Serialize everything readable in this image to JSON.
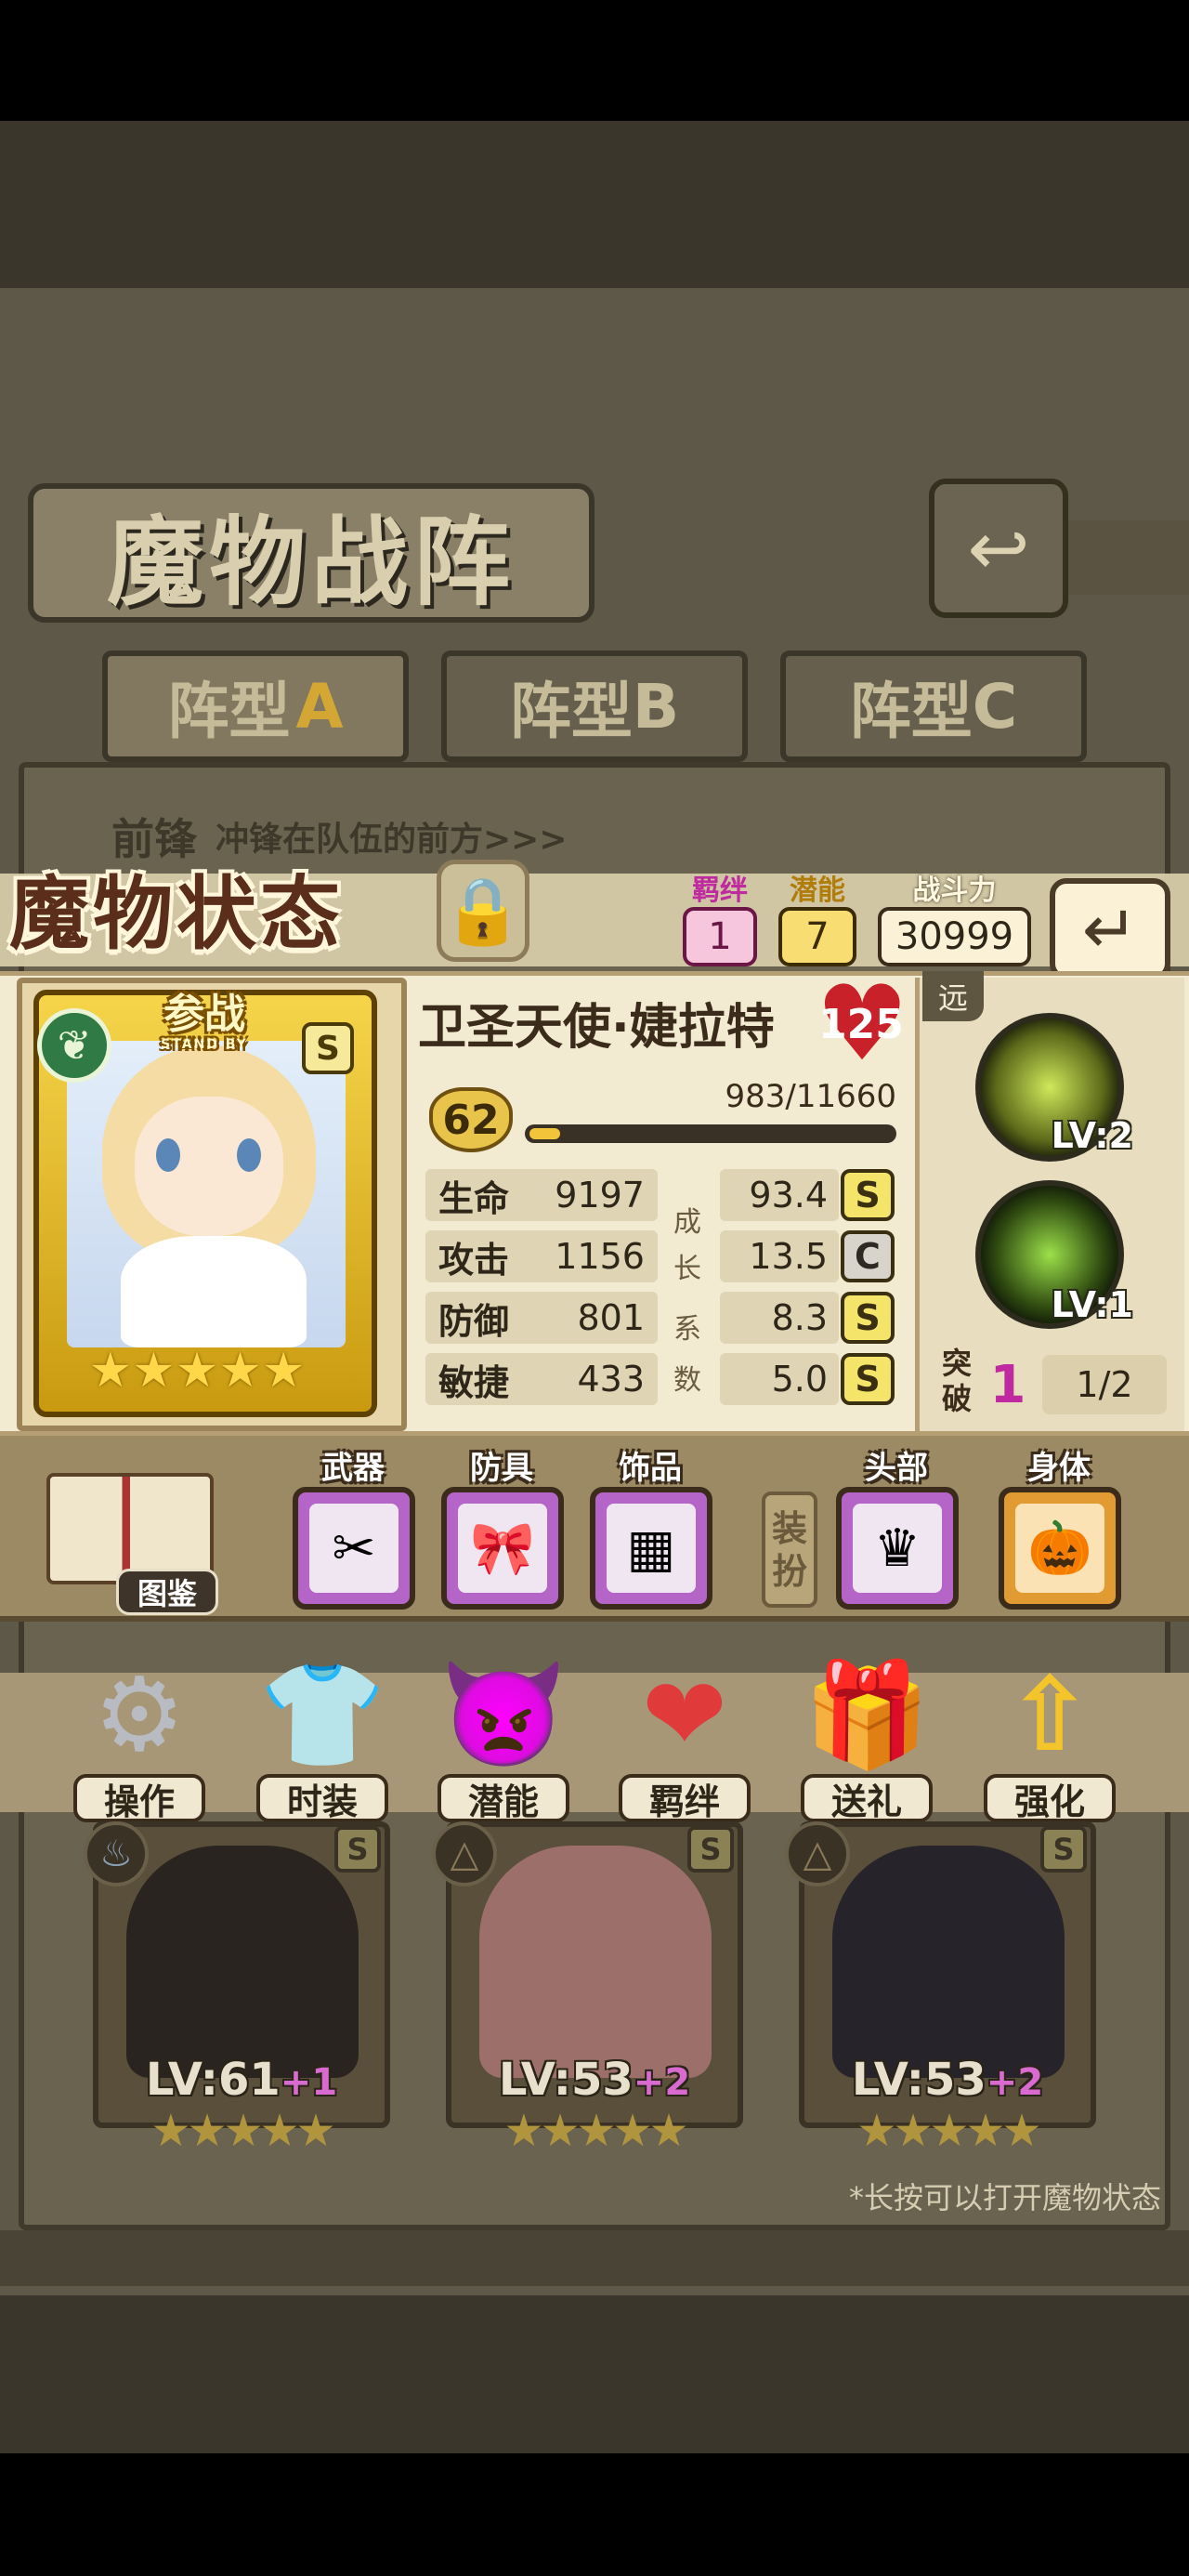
{
  "formation": {
    "title": "魔物战阵",
    "tabs": [
      {
        "label": "阵型",
        "letter": "A"
      },
      {
        "label": "阵型",
        "letter": "B"
      },
      {
        "label": "阵型",
        "letter": "C"
      }
    ],
    "vanguard_label": "前锋",
    "vanguard_desc": "冲锋在队伍的前方>>>",
    "hint": "*长按可以打开魔物状态"
  },
  "status": {
    "title": "魔物状态",
    "bond_label": "羁绊",
    "bond_value": "1",
    "potential_label": "潜能",
    "potential_value": "7",
    "power_label": "战斗力",
    "power_value": "30999"
  },
  "character": {
    "standby_cn": "参战",
    "standby_en": "STAND BY",
    "rank": "S",
    "name": "卫圣天使·婕拉特",
    "affection": "125",
    "level": "62",
    "exp_text": "983/11660",
    "exp_progress": 0.084,
    "stars": "★★★★★",
    "attack_range": "远"
  },
  "stats": [
    {
      "name": "生命",
      "value": "9197",
      "growth": "93.4",
      "grade": "S"
    },
    {
      "name": "攻击",
      "value": "1156",
      "growth": "13.5",
      "grade": "C"
    },
    {
      "name": "防御",
      "value": "801",
      "growth": "8.3",
      "grade": "S"
    },
    {
      "name": "敏捷",
      "value": "433",
      "growth": "5.0",
      "grade": "S"
    }
  ],
  "growth_vertical": [
    "成",
    "长",
    "系",
    "数"
  ],
  "skills": [
    {
      "level": "LV:2"
    },
    {
      "level": "LV:1"
    }
  ],
  "breakthrough": {
    "label_top": "突",
    "label_bottom": "破",
    "count": "1",
    "progress": "1/2"
  },
  "equipment": {
    "codex_label": "图鉴",
    "slots": [
      {
        "label": "武器",
        "icon": "✂"
      },
      {
        "label": "防具",
        "icon": "🎀"
      },
      {
        "label": "饰品",
        "icon": "▦"
      },
      {
        "label": "头部",
        "icon": "♛"
      },
      {
        "label": "身体",
        "icon": "🎃"
      }
    ],
    "dress_top": "装",
    "dress_bottom": "扮"
  },
  "actions": [
    {
      "label": "操作",
      "icon": "⚙"
    },
    {
      "label": "时装",
      "icon": "👕"
    },
    {
      "label": "潜能",
      "icon": "👿"
    },
    {
      "label": "羁绊",
      "icon": "❤"
    },
    {
      "label": "送礼",
      "icon": "🎁"
    },
    {
      "label": "强化",
      "icon": "⇧"
    }
  ],
  "team": [
    {
      "level": "LV:61",
      "plus": "+1",
      "grade": "S",
      "stars": "★★★★★"
    },
    {
      "level": "LV:53",
      "plus": "+2",
      "grade": "S",
      "stars": "★★★★★"
    },
    {
      "level": "LV:53",
      "plus": "+2",
      "grade": "S",
      "stars": "★★★★★"
    }
  ],
  "colors": {
    "accent_gold": "#f4c43a",
    "panel_bg": "#f3ebd1",
    "bond_pink": "#c02aa0"
  }
}
